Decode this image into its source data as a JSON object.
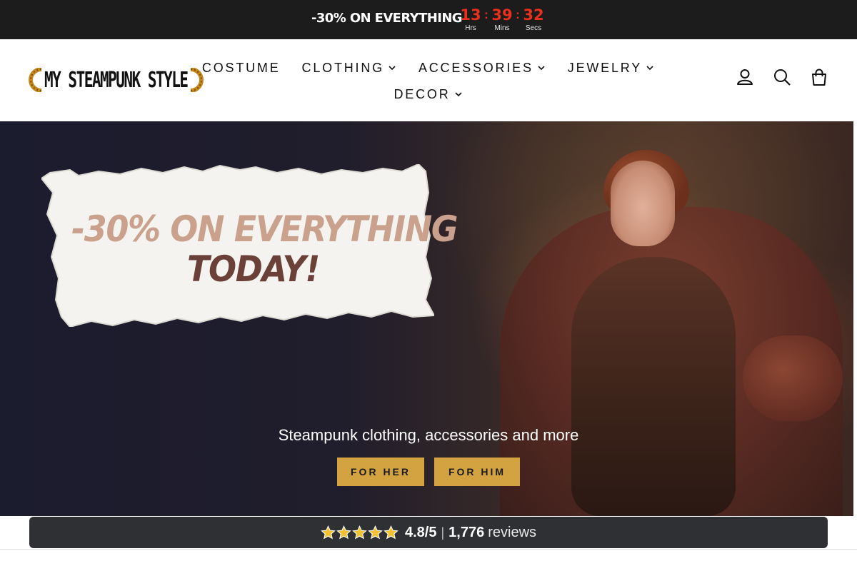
{
  "promo": {
    "text": "-30% ON EVERYTHING",
    "countdown": [
      {
        "value": "13",
        "label": "Hrs"
      },
      {
        "value": "39",
        "label": "Mins"
      },
      {
        "value": "32",
        "label": "Secs"
      }
    ],
    "separator": ":"
  },
  "header": {
    "logo_text": "MY STEAMPUNK STYLE",
    "nav": [
      {
        "label": "COSTUME",
        "has_dropdown": false
      },
      {
        "label": "CLOTHING",
        "has_dropdown": true
      },
      {
        "label": "ACCESSORIES",
        "has_dropdown": true
      },
      {
        "label": "JEWELRY",
        "has_dropdown": true
      },
      {
        "label": "DECOR",
        "has_dropdown": true
      }
    ],
    "icons": [
      "account-icon",
      "search-icon",
      "cart-icon"
    ]
  },
  "hero": {
    "banner_line1": "-30% ON EVERYTHING",
    "banner_line2": "TODAY!",
    "subtitle": "Steampunk clothing, accessories and more",
    "buttons": [
      {
        "label": "FOR HER"
      },
      {
        "label": "FOR HIM"
      }
    ]
  },
  "reviews": {
    "stars": 5,
    "rating": "4.8/5",
    "separator": "|",
    "count": "1,776",
    "word": "reviews"
  },
  "colors": {
    "promo_bg": "#1c1c1c",
    "countdown": "#e8301c",
    "button": "#d3a341",
    "reviews_bg": "#2f3033",
    "star": "#f2c230"
  }
}
